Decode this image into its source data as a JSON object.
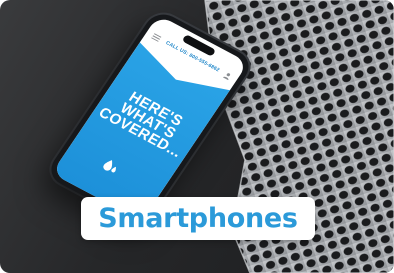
{
  "card": {
    "label": "Smartphones"
  },
  "phone_screen": {
    "call_text": "CALL US: 800-555-6862",
    "headline_lines": [
      "HERE'S",
      "WHAT'S",
      "COVERED..."
    ]
  },
  "icons": {
    "menu": "hamburger-menu-icon",
    "account": "user-icon",
    "water": "water-drop-icon"
  },
  "colors": {
    "brand_blue": "#2b9ad9",
    "screen_blue": "#1c8fd8",
    "background_dark": "#262729",
    "label_background": "#ffffff"
  }
}
